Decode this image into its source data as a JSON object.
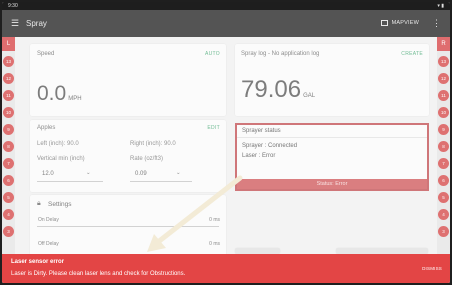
{
  "status_bar": {
    "time": "9:30"
  },
  "app_bar": {
    "menu_icon": "☰",
    "title": "Spray",
    "map_label": "MAPVIEW",
    "more_icon": "⋮"
  },
  "rails": {
    "left": {
      "header": "L",
      "dots": [
        "13",
        "12",
        "11",
        "10",
        "9",
        "8",
        "7",
        "6",
        "5",
        "4",
        "3"
      ]
    },
    "right": {
      "header": "R",
      "dots": [
        "13",
        "12",
        "11",
        "10",
        "9",
        "8",
        "7",
        "6",
        "5",
        "4",
        "3"
      ]
    }
  },
  "speed": {
    "label": "Speed",
    "action": "AUTO",
    "value": "0.0",
    "unit": "MPH"
  },
  "spray_log": {
    "label": "Spray log - No application log",
    "action": "CREATE",
    "value": "79.06",
    "unit": "GAL"
  },
  "apples": {
    "label": "Apples",
    "action": "EDIT",
    "left": "Left (inch): 90.0",
    "right": "Right (inch): 90.0",
    "vertical_label": "Vertical min (inch)",
    "vertical_value": "12.0",
    "rate_label": "Rate (oz/ft3)",
    "rate_value": "0.09"
  },
  "sprayer_status": {
    "title": "Sprayer status",
    "sprayer": "Sprayer : Connected",
    "laser": "Laser : Error",
    "status": "Status: Error"
  },
  "settings": {
    "title": "Settings",
    "rows": [
      {
        "label": "On Delay",
        "value": "0 ms"
      },
      {
        "label": "Off Delay",
        "value": "0 ms"
      }
    ]
  },
  "snackbar": {
    "title": "Laser sensor error",
    "message": "Laser is Dirty. Please clean laser lens and check for Obstructions.",
    "action": "DISMISS"
  },
  "colors": {
    "accent": "#2e9d62",
    "error": "#e34545",
    "appbar": "#545454",
    "rail_dot": "#cf2e2e"
  }
}
